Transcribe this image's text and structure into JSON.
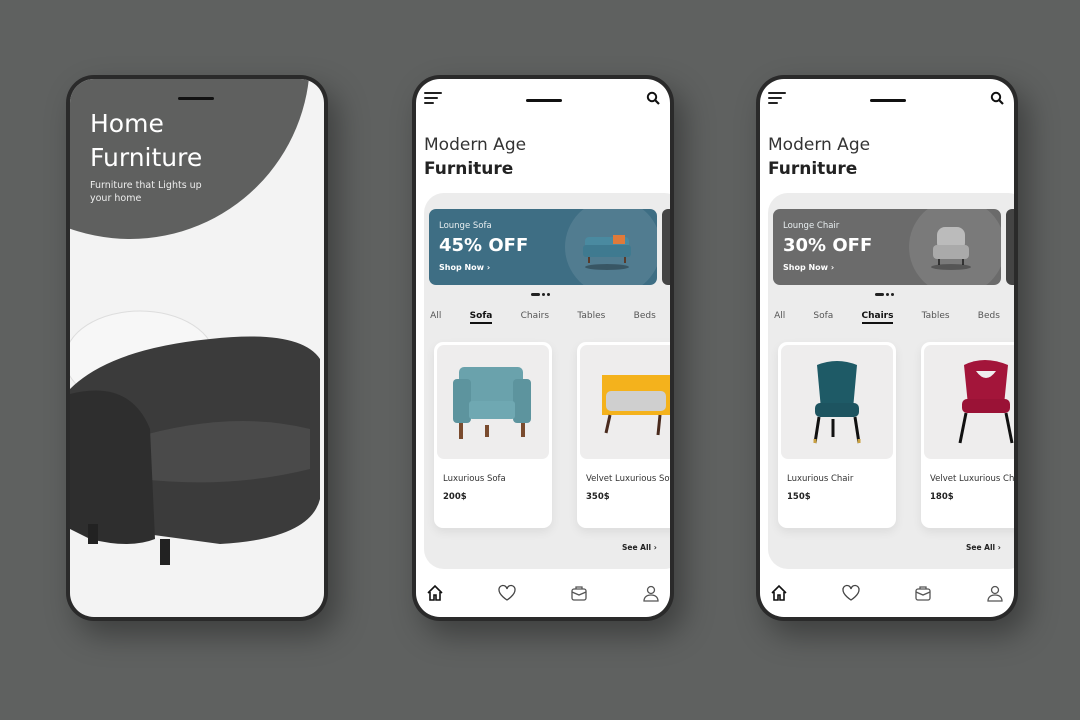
{
  "splash": {
    "title_line1": "Home",
    "title_line2": "Furniture",
    "subtitle": "Furniture that Lights up your home"
  },
  "screens": [
    {
      "heading_light": "Modern Age",
      "heading_bold": "Furniture",
      "banner": {
        "label": "Lounge Sofa",
        "discount": "45% OFF",
        "cta": "Shop Now ›",
        "color": "#3e6e84"
      },
      "tabs": [
        "All",
        "Sofa",
        "Chairs",
        "Tables",
        "Beds"
      ],
      "active_tab": "Sofa",
      "products": [
        {
          "name": "Luxurious Sofa",
          "price": "200$"
        },
        {
          "name": "Velvet Luxurious Sofa",
          "price": "350$"
        }
      ],
      "see_all": "See All ›"
    },
    {
      "heading_light": "Modern Age",
      "heading_bold": "Furniture",
      "banner": {
        "label": "Lounge Chair",
        "discount": "30% OFF",
        "cta": "Shop Now ›",
        "color": "#6b6b6b"
      },
      "tabs": [
        "All",
        "Sofa",
        "Chairs",
        "Tables",
        "Beds"
      ],
      "active_tab": "Chairs",
      "products": [
        {
          "name": "Luxurious Chair",
          "price": "150$"
        },
        {
          "name": "Velvet Luxurious Chair",
          "price": "180$"
        }
      ],
      "see_all": "See All ›"
    }
  ],
  "nav_icons": [
    "home-icon",
    "heart-icon",
    "bag-icon",
    "user-icon"
  ]
}
